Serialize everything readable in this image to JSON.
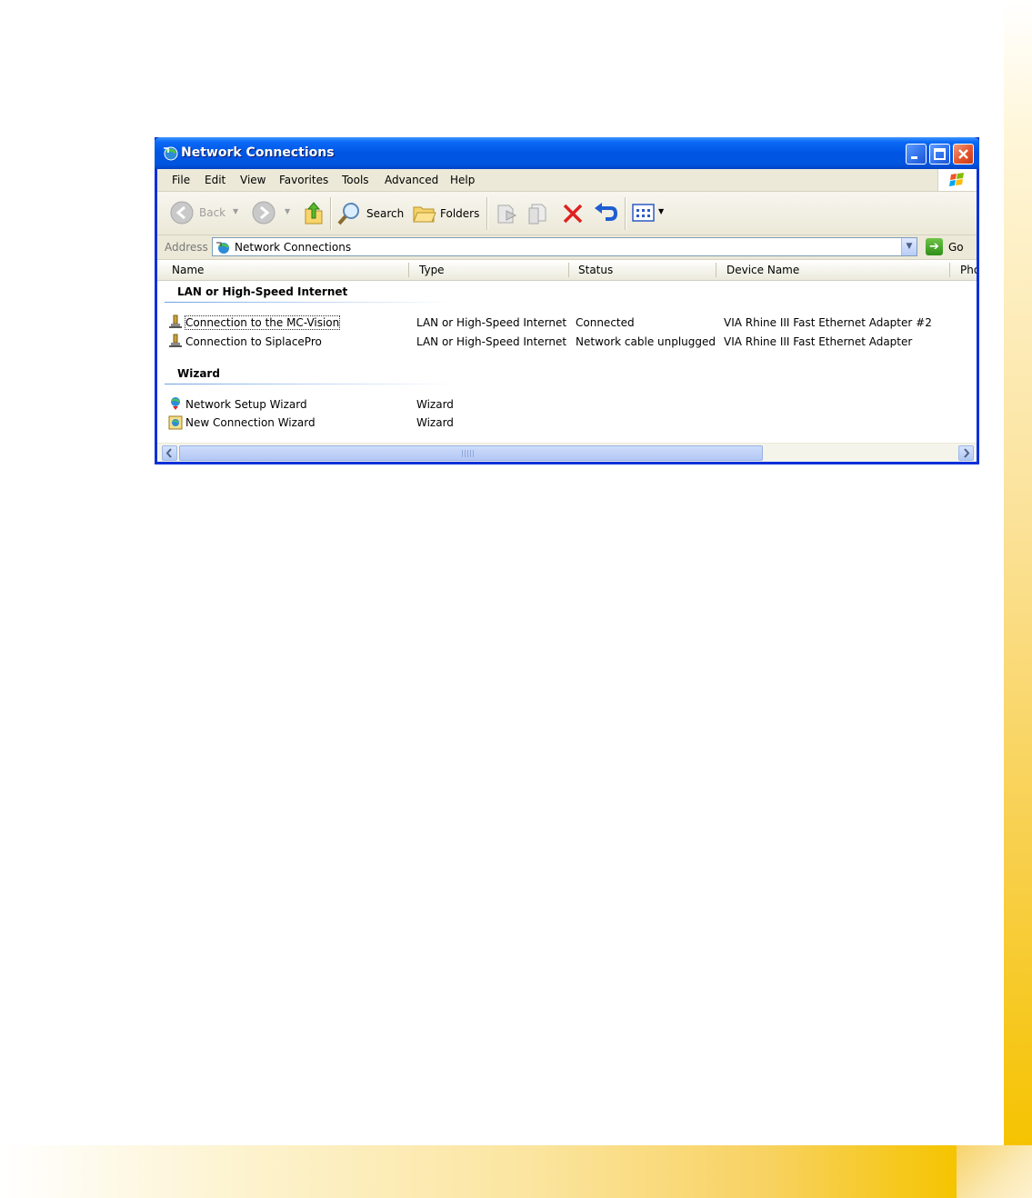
{
  "window": {
    "title": "Network Connections",
    "controls": [
      "minimize",
      "maximize",
      "close"
    ]
  },
  "menubar": {
    "items": [
      "File",
      "Edit",
      "View",
      "Favorites",
      "Tools",
      "Advanced",
      "Help"
    ]
  },
  "toolbar": {
    "back_label": "Back",
    "search_label": "Search",
    "folders_label": "Folders"
  },
  "address": {
    "label": "Address",
    "value": "Network Connections",
    "go_label": "Go"
  },
  "columns": [
    "Name",
    "Type",
    "Status",
    "Device Name",
    "Pho"
  ],
  "groups": [
    {
      "title": "LAN or High-Speed Internet",
      "items": [
        {
          "name": "Connection to the MC-Vision",
          "type": "LAN or High-Speed Internet",
          "status": "Connected",
          "device": "VIA Rhine III Fast Ethernet Adapter #2"
        },
        {
          "name": "Connection to SiplacePro",
          "type": "LAN or High-Speed Internet",
          "status": "Network cable unplugged",
          "device": "VIA Rhine III Fast Ethernet Adapter"
        }
      ]
    },
    {
      "title": "Wizard",
      "items": [
        {
          "name": "Network Setup Wizard",
          "type": "Wizard"
        },
        {
          "name": "New Connection Wizard",
          "type": "Wizard"
        }
      ]
    }
  ],
  "colors": {
    "titlebar": "#0055e3",
    "close_button": "#e5542c",
    "page_accent": "#f5c300"
  }
}
